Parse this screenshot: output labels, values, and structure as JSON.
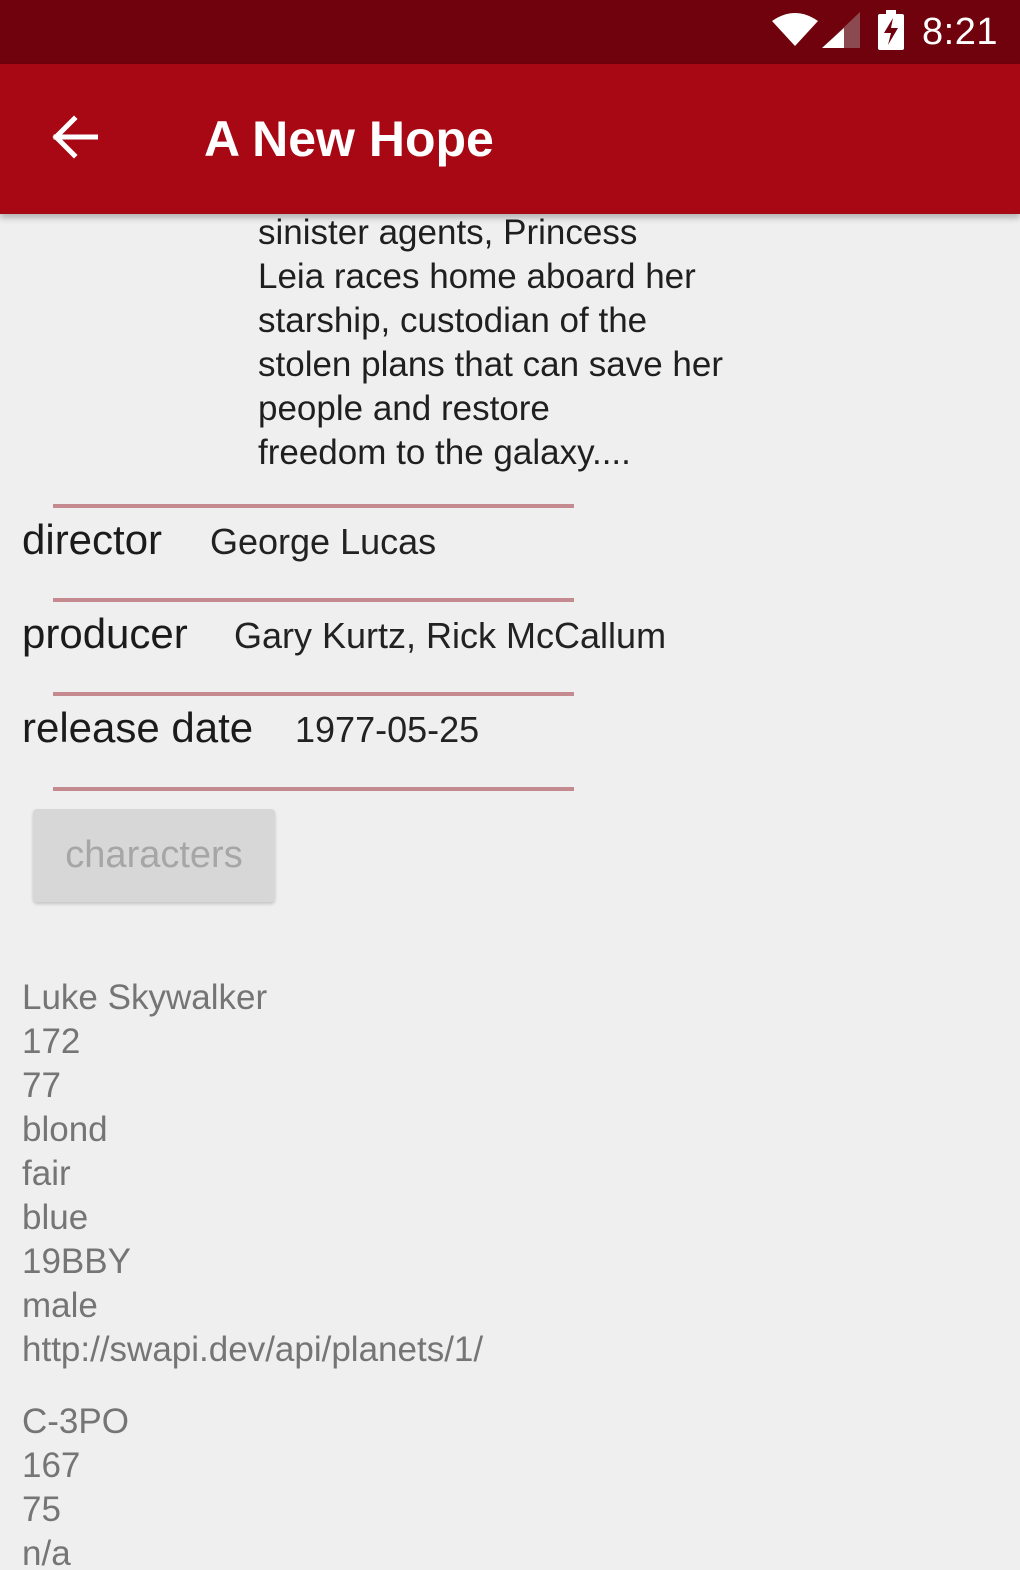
{
  "status_bar": {
    "time": "8:21",
    "icons": [
      "wifi-icon",
      "cellular-signal-icon",
      "battery-charging-icon"
    ]
  },
  "app_bar": {
    "title": "A New Hope",
    "back_icon": "arrow-left-icon"
  },
  "film": {
    "crawl_lines": [
      "sinister agents, Princess",
      "Leia races home aboard her",
      "starship, custodian of the",
      "stolen plans that can save her",
      "people and restore",
      "freedom to the galaxy...."
    ],
    "details": [
      {
        "label": "director",
        "value": "George Lucas"
      },
      {
        "label": "producer",
        "value": "Gary Kurtz, Rick McCallum"
      },
      {
        "label": "release date",
        "value": "1977-05-25"
      }
    ]
  },
  "characters_button_label": "characters",
  "characters": [
    {
      "lines": [
        "Luke Skywalker",
        "172",
        "77",
        "blond",
        "fair",
        "blue",
        "19BBY",
        "male",
        "http://swapi.dev/api/planets/1/"
      ]
    },
    {
      "lines": [
        "C-3PO",
        "167",
        "75",
        "n/a"
      ]
    }
  ],
  "colors": {
    "status_bar": "#6f020c",
    "app_bar": "#a80814",
    "background": "#efefef",
    "divider": "#c48a90"
  }
}
